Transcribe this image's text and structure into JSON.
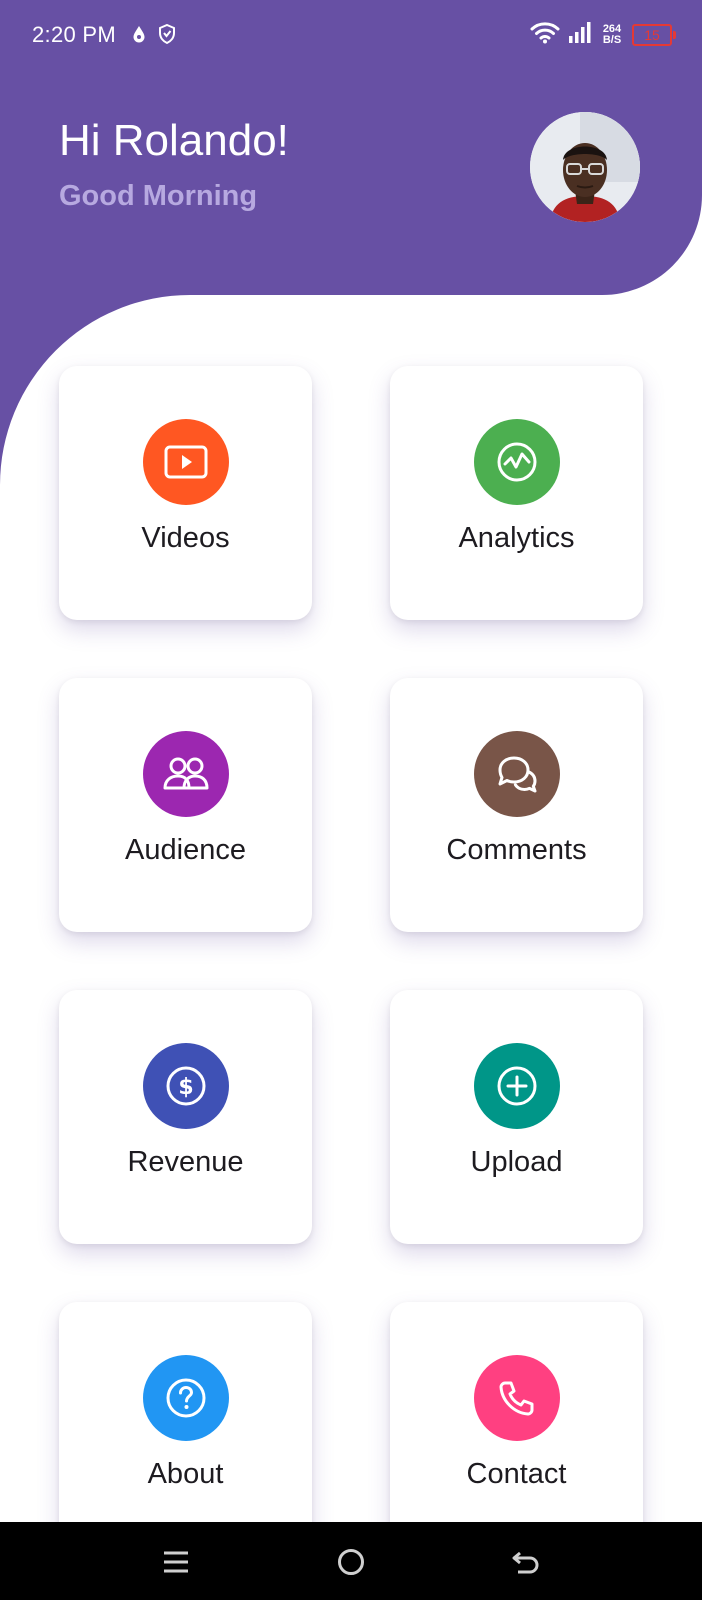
{
  "status_bar": {
    "time": "2:20 PM",
    "net_speed_value": "264",
    "net_speed_unit": "B/S",
    "battery": "15"
  },
  "header": {
    "greeting": "Hi Rolando!",
    "subtitle": "Good Morning",
    "avatar": "user-photo"
  },
  "colors": {
    "primary": "#6750a4",
    "subtitle": "#b7a9e0",
    "videos": "#ff5722",
    "analytics": "#4caf50",
    "audience": "#9c27b0",
    "comments": "#795548",
    "revenue": "#3f51b5",
    "upload": "#009688",
    "about": "#2196f3",
    "contact": "#ff4081"
  },
  "menu": {
    "items": [
      {
        "label": "Videos",
        "icon": "play-icon"
      },
      {
        "label": "Analytics",
        "icon": "chart-icon"
      },
      {
        "label": "Audience",
        "icon": "people-icon"
      },
      {
        "label": "Comments",
        "icon": "chat-icon"
      },
      {
        "label": "Revenue",
        "icon": "dollar-icon"
      },
      {
        "label": "Upload",
        "icon": "add-icon"
      },
      {
        "label": "About",
        "icon": "help-icon"
      },
      {
        "label": "Contact",
        "icon": "phone-icon"
      }
    ]
  },
  "nav_bar": {
    "buttons": [
      "menu-icon",
      "home-icon",
      "back-icon"
    ]
  }
}
